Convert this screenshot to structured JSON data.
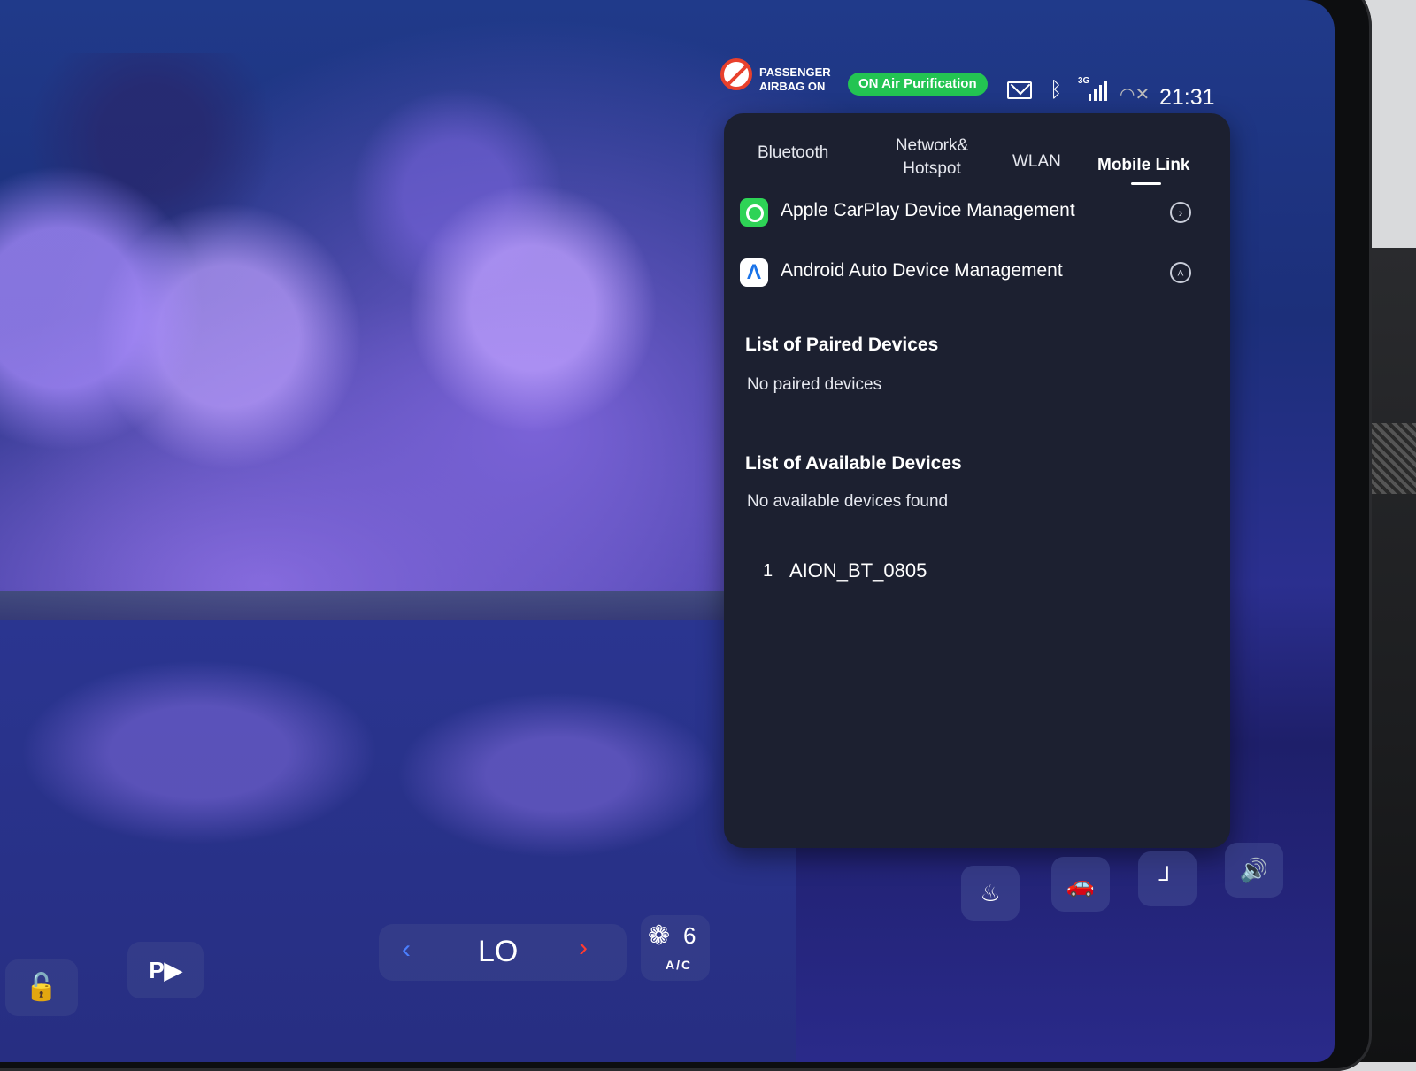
{
  "status_bar": {
    "airbag_line1": "PASSENGER",
    "airbag_line2": "AIRBAG ON",
    "air_purification": "ON Air Purification",
    "network_type": "3G",
    "time": "21:31"
  },
  "panel": {
    "tabs": [
      {
        "label": "Bluetooth"
      },
      {
        "label": "Network&"
      },
      {
        "label": "Hotspot"
      },
      {
        "label": "WLAN"
      },
      {
        "label": "Mobile Link"
      }
    ],
    "active_tab": "Mobile Link",
    "carplay": {
      "label": "Apple CarPlay Device Management"
    },
    "android_auto": {
      "label": "Android Auto Device Management"
    },
    "paired": {
      "title": "List of Paired Devices",
      "empty": "No paired devices"
    },
    "available": {
      "title": "List of Available Devices",
      "empty": "No available devices found",
      "devices": [
        {
          "index": "1",
          "name": "AION_BT_0805"
        }
      ]
    }
  },
  "climate": {
    "temperature": "LO",
    "fan_level": "6",
    "ac_label": "A/C"
  },
  "colors": {
    "panel_bg": "#1c2030",
    "air_badge": "#23c452",
    "airbag_icon": "#e8402c",
    "temp_down_arrow": "#4b7fff",
    "temp_up_arrow": "#ff3b30"
  },
  "icons": {
    "airbag": "airbag-off-icon",
    "mail": "mail-icon",
    "bluetooth": "bluetooth-icon",
    "signal": "signal-icon",
    "wifi": "wifi-off-icon",
    "carplay": "carplay-icon",
    "android_auto": "android-auto-icon",
    "lock": "lock-icon",
    "camera": "parking-camera-icon",
    "fan": "fan-icon",
    "defrost": "rear-defrost-icon",
    "car_ac": "auto-ac-car-icon",
    "seat": "seat-icon",
    "volume": "volume-icon"
  }
}
